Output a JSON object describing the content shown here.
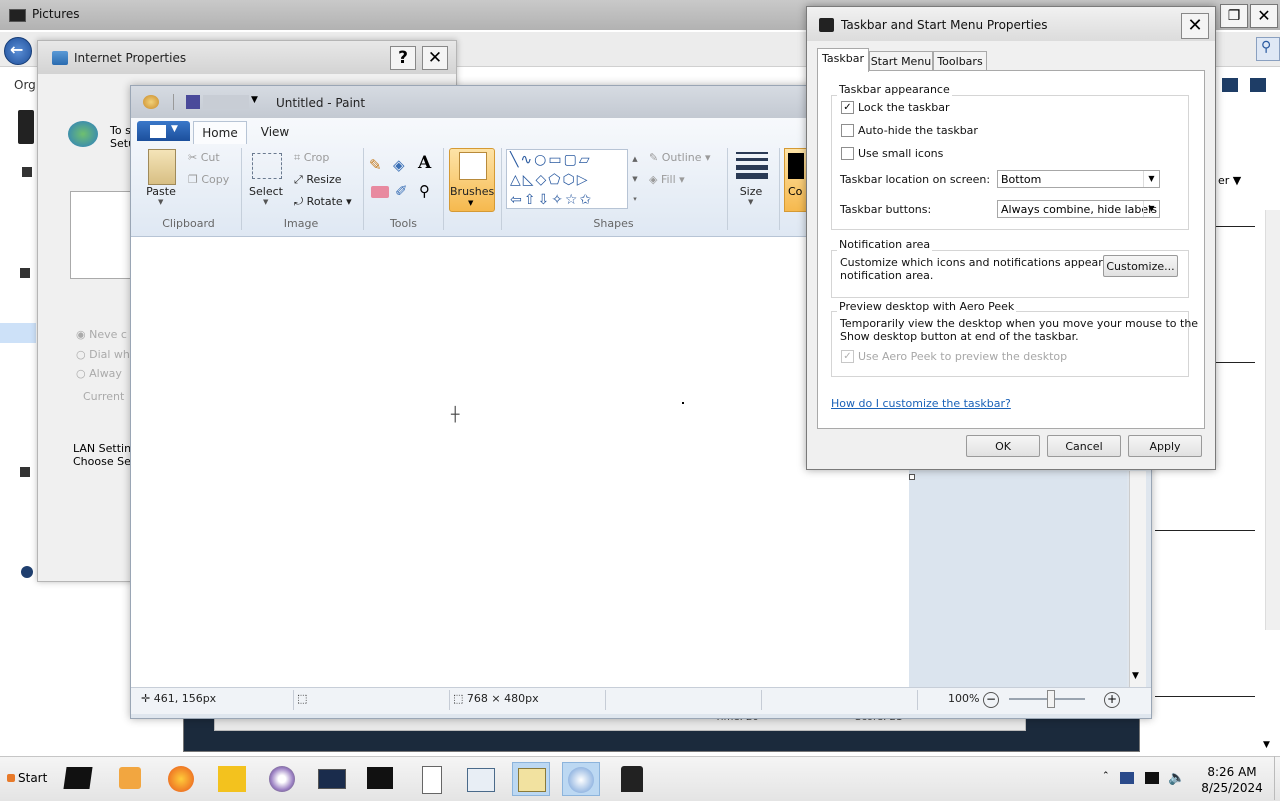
{
  "explorer": {
    "title": "Pictures",
    "organize_label": "Org",
    "partial_right_label": "er"
  },
  "internet_properties": {
    "title": "Internet Properties",
    "partial_text_1": "To s",
    "partial_text_2": "Setu",
    "radio_1": "Neve c",
    "radio_2": "Dial whe",
    "radio_3": "Alway",
    "current_label": "Current",
    "lan_title": "LAN Setting",
    "lan_sub": "Choose Set"
  },
  "paint": {
    "title": "Untitled - Paint",
    "tabs": {
      "home": "Home",
      "view": "View"
    },
    "clipboard": {
      "paste": "Paste",
      "cut": "Cut",
      "copy": "Copy",
      "group": "Clipboard"
    },
    "image": {
      "select": "Select",
      "crop": "Crop",
      "resize": "Resize",
      "rotate": "Rotate",
      "group": "Image"
    },
    "tools": {
      "group": "Tools"
    },
    "brushes": {
      "label": "Brushes"
    },
    "shapes": {
      "outline": "Outline",
      "fill": "Fill",
      "group": "Shapes"
    },
    "size": {
      "label": "Size"
    },
    "colors": {
      "partial": "Co"
    },
    "status": {
      "cursor_pos": "461, 156px",
      "canvas_size": "768 × 480px",
      "zoom": "100%"
    },
    "behind_text_1": "Time: 20",
    "behind_text_2": "Score: 21"
  },
  "taskbar_props": {
    "title": "Taskbar and Start Menu Properties",
    "tabs": [
      "Taskbar",
      "Start Menu",
      "Toolbars"
    ],
    "appearance": {
      "title": "Taskbar appearance",
      "lock": "Lock the taskbar",
      "autohide": "Auto-hide the taskbar",
      "small_icons": "Use small icons",
      "location_label": "Taskbar location on screen:",
      "location_value": "Bottom",
      "buttons_label": "Taskbar buttons:",
      "buttons_value": "Always combine, hide labels"
    },
    "notification": {
      "title": "Notification area",
      "text_line1": "Customize which icons and notifications appear in the",
      "text_line2": "notification area.",
      "customize": "Customize..."
    },
    "aero_peek": {
      "title": "Preview desktop with Aero Peek",
      "text_line1": "Temporarily view the desktop when you move your mouse to the",
      "text_line2": "Show desktop button at end of the taskbar.",
      "checkbox": "Use Aero Peek to preview the desktop"
    },
    "help_link": "How do I customize the taskbar?",
    "buttons": {
      "ok": "OK",
      "cancel": "Cancel",
      "apply": "Apply"
    }
  },
  "taskbar": {
    "start": "Start",
    "time": "8:26 AM",
    "date": "8/25/2024"
  },
  "colors": {
    "accent": "#1c4f9c",
    "brushes_highlight": "#f8c86a",
    "link": "#1a62b8"
  }
}
